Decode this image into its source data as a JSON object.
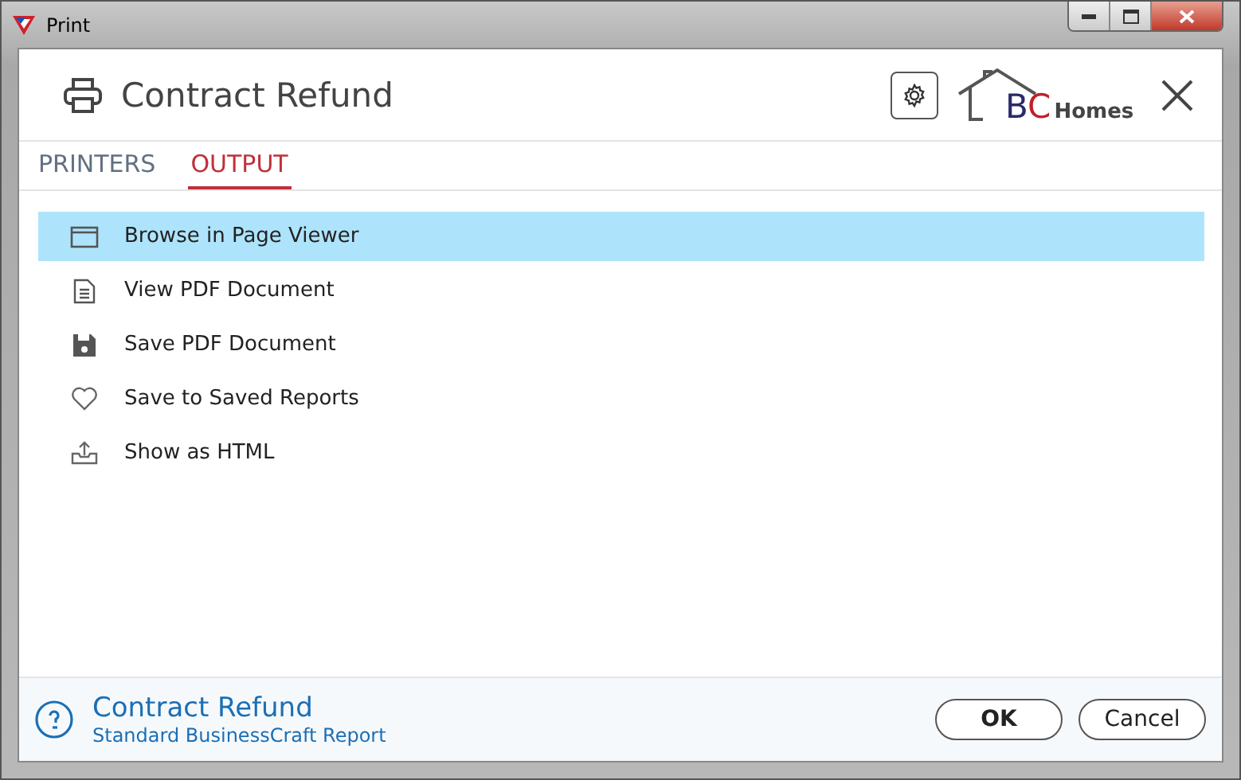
{
  "window": {
    "title": "Print"
  },
  "header": {
    "title": "Contract Refund",
    "logo": {
      "part_1": "BC",
      "part_2": "Homes"
    }
  },
  "tabs": [
    {
      "label": "PRINTERS",
      "selected": false
    },
    {
      "label": "OUTPUT",
      "selected": true
    }
  ],
  "output_options": [
    {
      "kind": "window",
      "label": "Browse in Page Viewer",
      "selected": true
    },
    {
      "kind": "document",
      "label": "View PDF Document",
      "selected": false
    },
    {
      "kind": "disk",
      "label": "Save PDF Document",
      "selected": false
    },
    {
      "kind": "heart",
      "label": "Save to Saved Reports",
      "selected": false
    },
    {
      "kind": "upload",
      "label": "Show as HTML",
      "selected": false
    }
  ],
  "footer": {
    "title": "Contract Refund",
    "subtitle": "Standard BusinessCraft Report",
    "buttons": [
      "OK",
      "Cancel"
    ]
  }
}
